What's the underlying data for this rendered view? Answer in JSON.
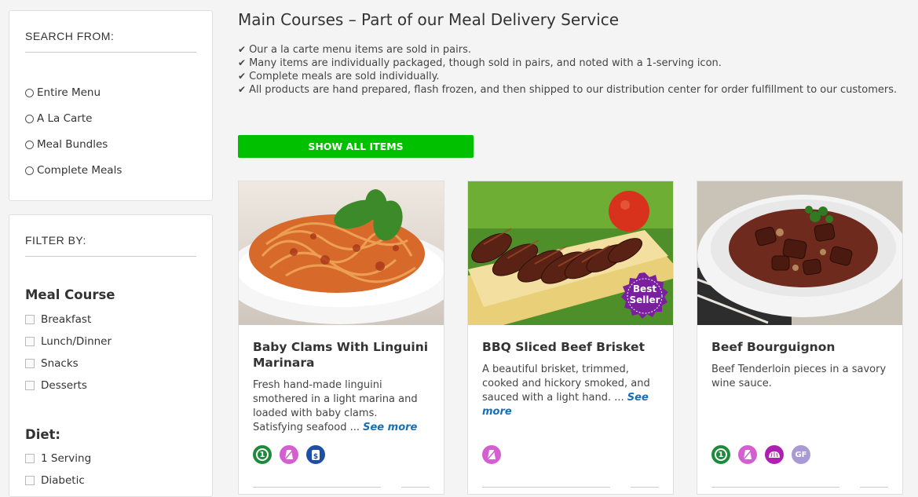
{
  "sidebar": {
    "search_title": "SEARCH FROM:",
    "search_options": [
      "Entire Menu",
      "A La Carte",
      "Meal Bundles",
      "Complete Meals"
    ],
    "filter_title": "FILTER BY:",
    "meal_course_title": "Meal Course",
    "meal_course_options": [
      "Breakfast",
      "Lunch/Dinner",
      "Snacks",
      "Desserts"
    ],
    "diet_title": "Diet:",
    "diet_options": [
      "1 Serving",
      "Diabetic"
    ]
  },
  "main": {
    "title": "Main Courses – Part of our Meal Delivery Service",
    "bullets": [
      "Our a la carte menu items are sold in pairs.",
      "Many items are individually packaged, though sold in pairs, and noted with a 1-serving icon.",
      "Complete meals are sold individually.",
      "All products are hand prepared, flash frozen, and then shipped to our distribution center for order fulfillment to our customers."
    ],
    "show_all_label": "SHOW ALL ITEMS"
  },
  "cards": [
    {
      "title": "Baby Clams With Linguini Marinara",
      "desc": "Fresh hand-made linguini smothered in a light marina and loaded with baby clams. Satisfying seafood ...",
      "see_more": "See more",
      "icons": [
        "one-serving-icon",
        "no-salt-icon",
        "low-cost-icon"
      ]
    },
    {
      "title": "BBQ Sliced Beef Brisket",
      "desc": "A beautiful brisket, trimmed, cooked and hickory smoked, and sauced with a light hand. ...",
      "see_more": "See more",
      "badge_line1": "Best",
      "badge_line2": "Seller",
      "icons": [
        "no-salt-icon"
      ]
    },
    {
      "title": "Beef Bourguignon",
      "desc": "Beef Tenderloin pieces in a savory wine sauce.",
      "icons": [
        "one-serving-icon",
        "no-salt-icon",
        "bread-icon",
        "gluten-free-icon"
      ],
      "gf_label": "GF",
      "one_label": "1"
    }
  ],
  "colors": {
    "accent_green": "#00c000",
    "link_blue": "#1a6fb3",
    "one_serving_green": "#1e8a3c",
    "no_salt_pink": "#d35fd0",
    "low_cost_blue": "#1f4fa3",
    "bread_purple": "#b020b0",
    "gf_lavender": "#a99ad6",
    "best_seller_purple": "#7a1fa0"
  }
}
